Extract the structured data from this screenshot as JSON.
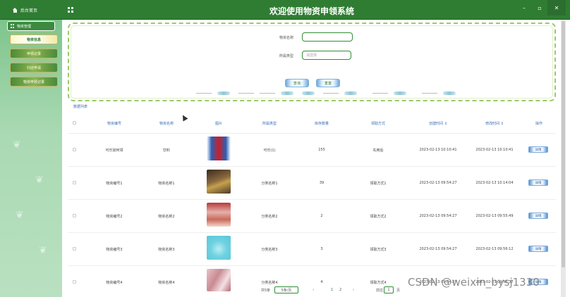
{
  "app": {
    "title": "欢迎使用物资申领系统",
    "home_label": "后台首页"
  },
  "window": {
    "min": "–",
    "max": "▫",
    "close": "✕"
  },
  "sidebar": {
    "parent_label": "物资管理",
    "items": [
      {
        "label": "物资信息",
        "active": true
      },
      {
        "label": "申领记录",
        "active": false
      },
      {
        "label": "归还申请",
        "active": false
      },
      {
        "label": "物资申领记录",
        "active": false
      }
    ]
  },
  "search": {
    "field1_label": "物资名称",
    "field1_value": "",
    "field2_label": "所属类型",
    "field2_placeholder": "请选择",
    "search_button": "查询",
    "reset_button": "重置"
  },
  "table": {
    "title": "数据列表",
    "columns": [
      "物资编号",
      "物资名称",
      "图片",
      "所属类型",
      "库存数量",
      "领取方式",
      "创建时间 ↕",
      "修改时间 ↕",
      "操作"
    ],
    "rows": [
      {
        "code": "可乐如何领",
        "name": "饮料",
        "type": "可乐(1)",
        "qty": "155",
        "method": "先用后",
        "created": "2023-02-13 10:10:41",
        "updated": "2023-02-13 10:10:41",
        "image_color": "#2a5fb5",
        "op": "详情"
      },
      {
        "code": "物资编号1",
        "name": "物资名称1",
        "type": "分类名称1",
        "qty": "39",
        "method": "领取方式1",
        "created": "2023-02-13 09:54:27",
        "updated": "2023-02-13 10:14:04",
        "image_color": "#6b4a2f",
        "op": "详情"
      },
      {
        "code": "物资编号2",
        "name": "物资名称2",
        "type": "分类名称2",
        "qty": "2",
        "method": "领取方式2",
        "created": "2023-02-13 09:54:27",
        "updated": "2023-02-13 09:55:49",
        "image_color": "#c97a6a",
        "op": "详情"
      },
      {
        "code": "物资编号3",
        "name": "物资名称3",
        "type": "分类名称3",
        "qty": "3",
        "method": "领取方式3",
        "created": "2023-02-13 09:54:27",
        "updated": "2023-02-13 09:56:12",
        "image_color": "#6fd2e0",
        "op": "详情"
      },
      {
        "code": "物资编号4",
        "name": "物资名称4",
        "type": "分类名称4",
        "qty": "4",
        "method": "领取方式4",
        "created": "2023-02-13 09:54:27",
        "updated": "2023-02-13 09:56:37",
        "image_color": "#d9a1a8",
        "op": "详情"
      }
    ]
  },
  "pagination": {
    "total": "共5条",
    "page_size": "5条/页",
    "prev": "‹",
    "page1": "1",
    "page2": "2",
    "next": "›",
    "goto_label": "前往",
    "goto_value": "1",
    "goto_suffix": "页"
  },
  "watermark": "CSDN @weixin_bysj1330"
}
